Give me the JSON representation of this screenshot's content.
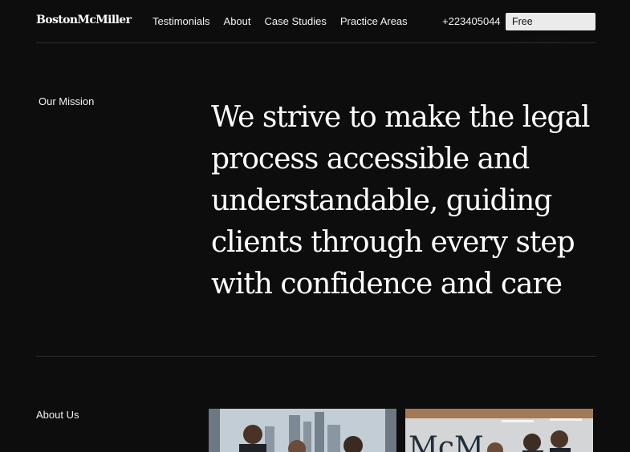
{
  "header": {
    "logo": "BostonMcMiller",
    "nav": [
      "Testimonials",
      "About",
      "Case Studies",
      "Practice Areas"
    ],
    "phone": "+223405044",
    "cta": "Free Consultation"
  },
  "mission": {
    "label": "Our Mission",
    "text": "We strive to make the legal process accessible and understandable, guiding clients through every step with confidence and care"
  },
  "about": {
    "label": "About Us",
    "photo2_sign": "McM"
  }
}
